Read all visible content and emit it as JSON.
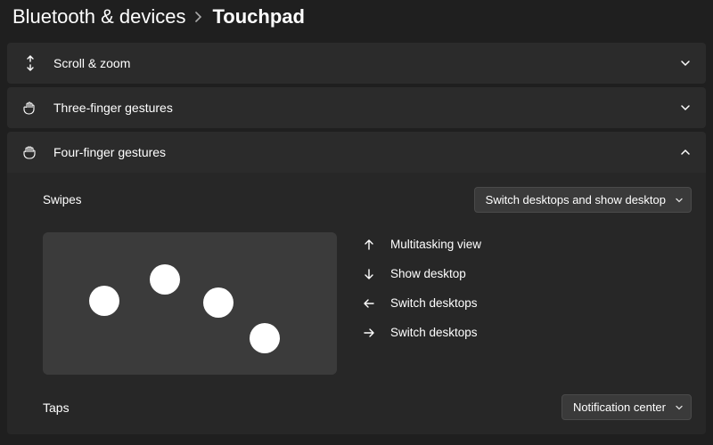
{
  "breadcrumb": {
    "parent": "Bluetooth & devices",
    "current": "Touchpad"
  },
  "sections": {
    "scroll_zoom": {
      "label": "Scroll & zoom"
    },
    "three_finger": {
      "label": "Three-finger gestures"
    },
    "four_finger": {
      "label": "Four-finger gestures",
      "swipes_label": "Swipes",
      "swipes_value": "Switch desktops and show desktop",
      "directions": {
        "up": "Multitasking view",
        "down": "Show desktop",
        "left": "Switch desktops",
        "right": "Switch desktops"
      },
      "taps_label": "Taps",
      "taps_value": "Notification center"
    }
  }
}
